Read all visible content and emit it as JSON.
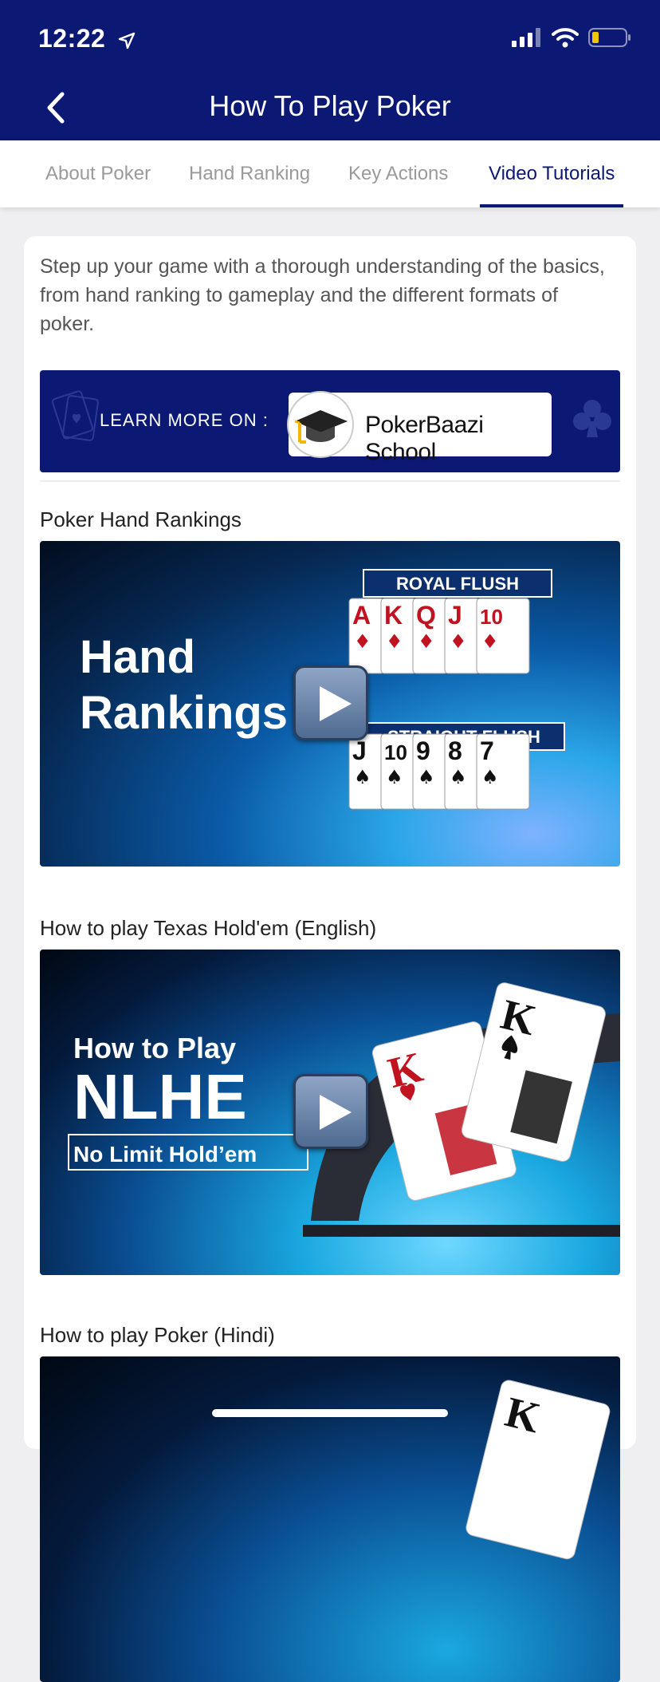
{
  "status_bar": {
    "time": "12:22"
  },
  "header": {
    "title": "How To Play Poker"
  },
  "tabs": [
    {
      "label": "About Poker"
    },
    {
      "label": "Hand Ranking"
    },
    {
      "label": "Key Actions"
    },
    {
      "label": "Video Tutorials",
      "active": true
    }
  ],
  "content": {
    "intro": "Step up your game with a thorough understanding of the basics, from hand ranking to gameplay and the different formats of poker.",
    "banner": {
      "prefix": "LEARN MORE ON :",
      "brand": "PokerBaazi School"
    },
    "videos": [
      {
        "title": "Poker Hand Rankings",
        "thumb": {
          "line1": "Hand",
          "line2": "Rankings",
          "tag1": "ROYAL FLUSH",
          "tag2": "STRAIGHT FLUSH",
          "cards1": [
            "A",
            "K",
            "Q",
            "J",
            "10"
          ],
          "cards2": [
            "J",
            "10",
            "9",
            "8",
            "7"
          ]
        }
      },
      {
        "title": "How to play Texas Hold'em (English)",
        "thumb": {
          "line1": "How to Play",
          "line2": "NLHE",
          "line3": "No Limit Hold’em",
          "card1": "K",
          "card2": "K"
        }
      },
      {
        "title": "How to play Poker (Hindi)",
        "thumb": {
          "card": "K"
        }
      }
    ]
  },
  "colors": {
    "brand": "#0b1874",
    "suit_red": "#c0121f"
  }
}
